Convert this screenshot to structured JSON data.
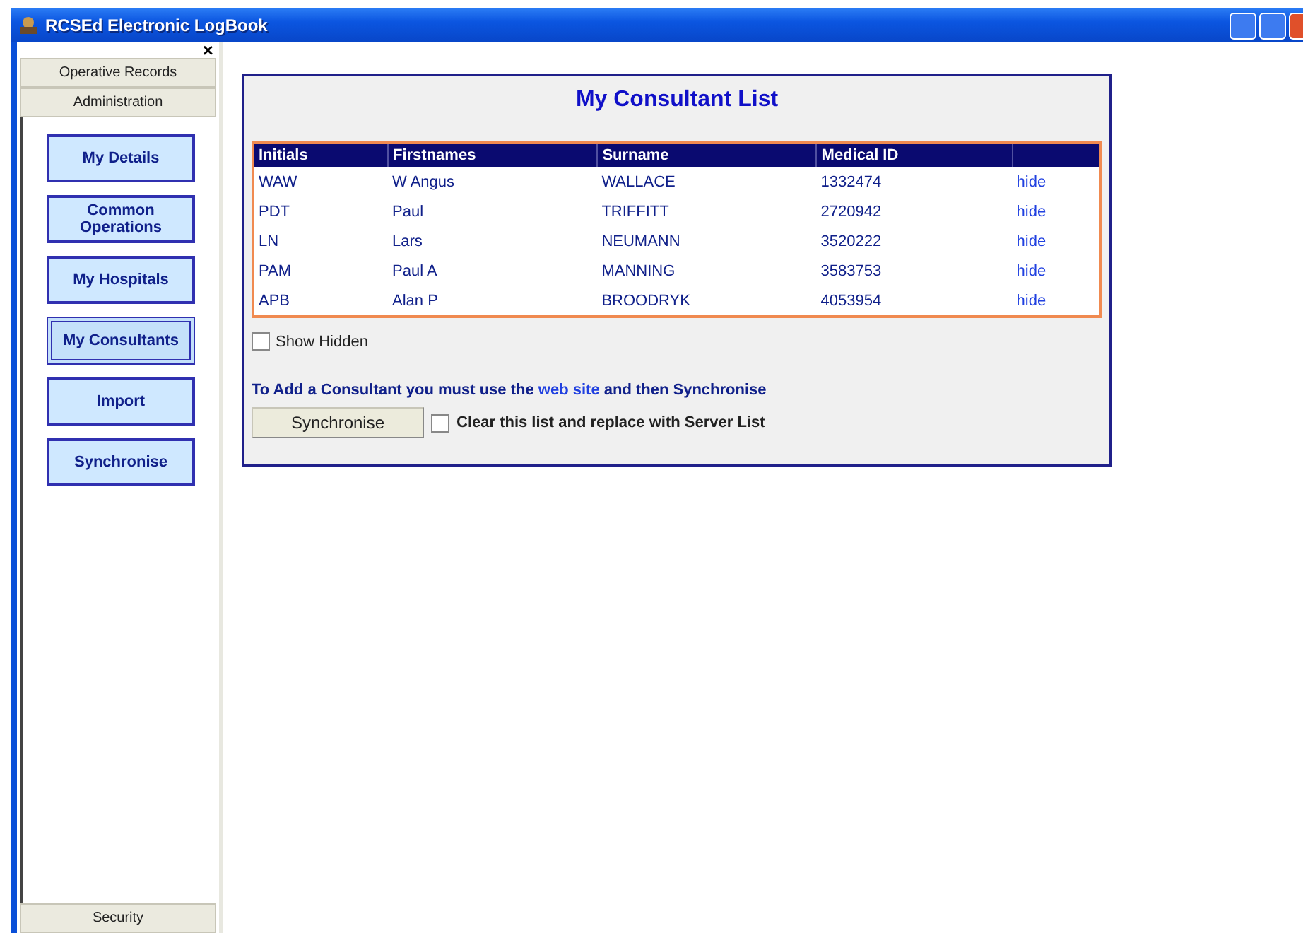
{
  "window": {
    "title": "RCSEd Electronic LogBook",
    "close_glyph": "×"
  },
  "sidebar": {
    "sections": [
      {
        "label": "Operative Records"
      },
      {
        "label": "Administration"
      }
    ],
    "items": [
      {
        "label": "My Details",
        "selected": false
      },
      {
        "label": "Common Operations",
        "selected": false
      },
      {
        "label": "My Hospitals",
        "selected": false
      },
      {
        "label": "My Consultants",
        "selected": true
      },
      {
        "label": "Import",
        "selected": false
      },
      {
        "label": "Synchronise",
        "selected": false
      }
    ],
    "bottom_section": {
      "label": "Security"
    }
  },
  "panel": {
    "title": "My Consultant List",
    "table": {
      "columns": [
        "Initials",
        "Firstnames",
        "Surname",
        "Medical ID"
      ],
      "rows": [
        {
          "cells": [
            "WAW",
            "W Angus",
            "WALLACE",
            "1332474"
          ],
          "action": "hide"
        },
        {
          "cells": [
            "PDT",
            "Paul",
            "TRIFFITT",
            "2720942"
          ],
          "action": "hide"
        },
        {
          "cells": [
            "LN",
            "Lars",
            "NEUMANN",
            "3520222"
          ],
          "action": "hide"
        },
        {
          "cells": [
            "PAM",
            "Paul A",
            "MANNING",
            "3583753"
          ],
          "action": "hide"
        },
        {
          "cells": [
            "APB",
            "Alan P",
            "BROODRYK",
            "4053954"
          ],
          "action": "hide"
        }
      ]
    },
    "show_hidden": {
      "label": "Show Hidden",
      "checked": false
    },
    "note": {
      "before": "To Add a Consultant you must use the",
      "link": "web site",
      "after": "and then Synchronise"
    },
    "sync_button": "Synchronise",
    "clear_list": {
      "label": "Clear this list and replace with Server List",
      "checked": false
    }
  }
}
